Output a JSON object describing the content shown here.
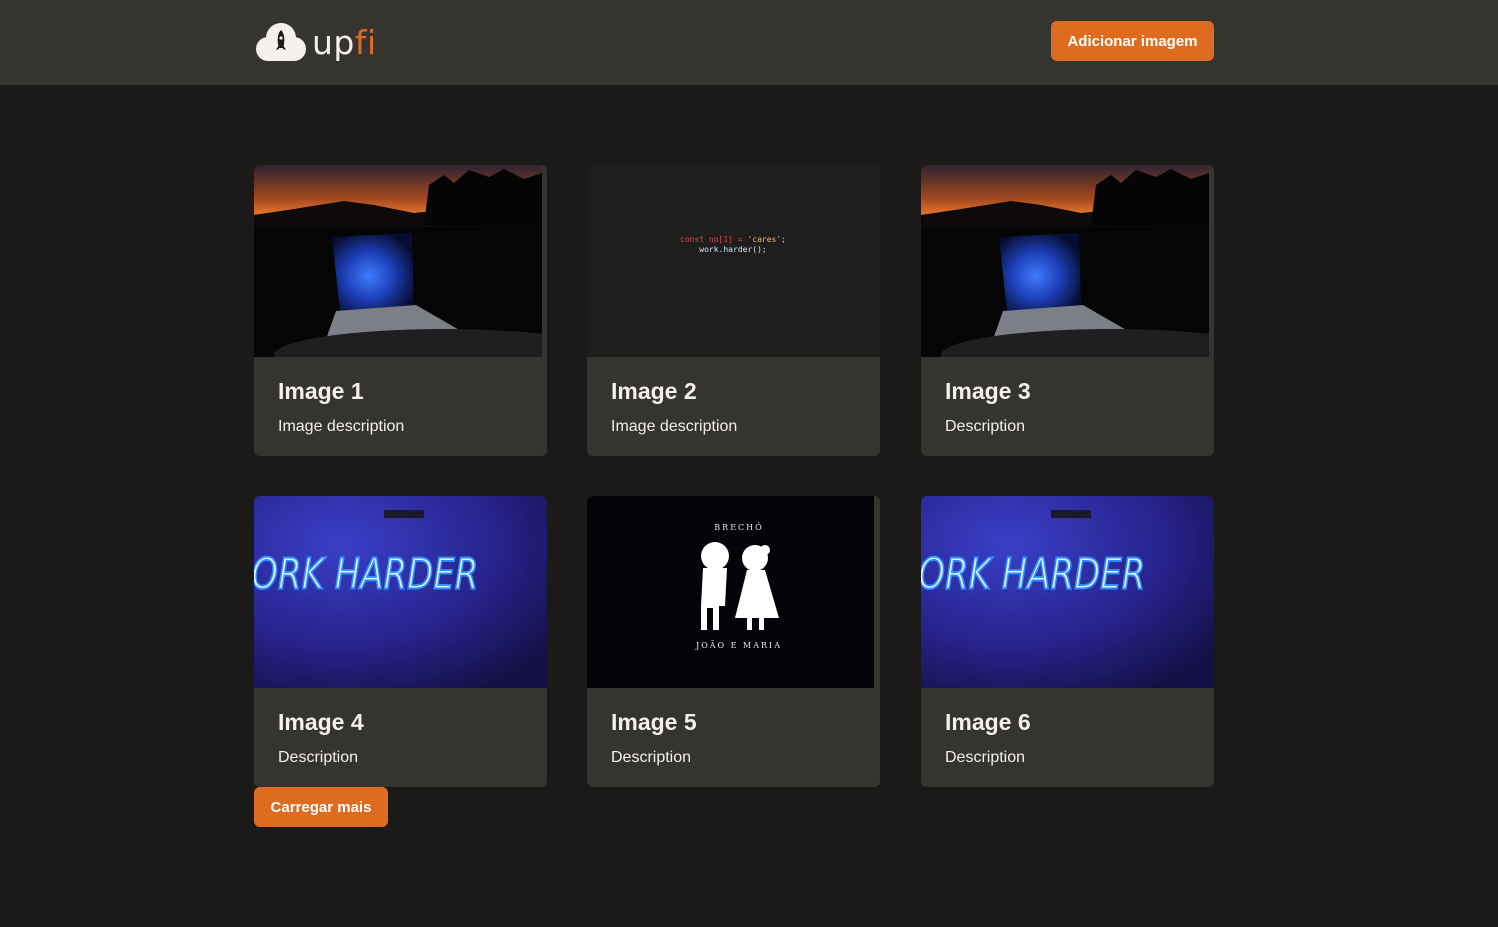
{
  "header": {
    "logo": {
      "up": "up",
      "fi": "fi"
    },
    "add_button_label": "Adicionar imagem"
  },
  "cards": [
    {
      "title": "Image 1",
      "description": "Image description",
      "image": "laptop-sunset"
    },
    {
      "title": "Image 2",
      "description": "Image description",
      "image": "code-snippet"
    },
    {
      "title": "Image 3",
      "description": "Description",
      "image": "laptop-sunset"
    },
    {
      "title": "Image 4",
      "description": "Description",
      "image": "neon-work-harder"
    },
    {
      "title": "Image 5",
      "description": "Description",
      "image": "joao-e-maria-logo"
    },
    {
      "title": "Image 6",
      "description": "Description",
      "image": "neon-work-harder"
    }
  ],
  "image_text": {
    "code_line1_a": "const no[1] = ",
    "code_line1_b": "'cares'",
    "code_line1_c": ";",
    "code_line2": "work.harder();",
    "neon": "WORK HARDER",
    "brecho": "BRECHÓ",
    "joao_maria": "JOÃO  E MARIA"
  },
  "load_more_label": "Carregar mais",
  "colors": {
    "accent": "#dd6b20",
    "header_bg": "#353431",
    "page_bg": "#1b1a19",
    "card_bg": "#353431",
    "text": "#f4f0eb"
  }
}
